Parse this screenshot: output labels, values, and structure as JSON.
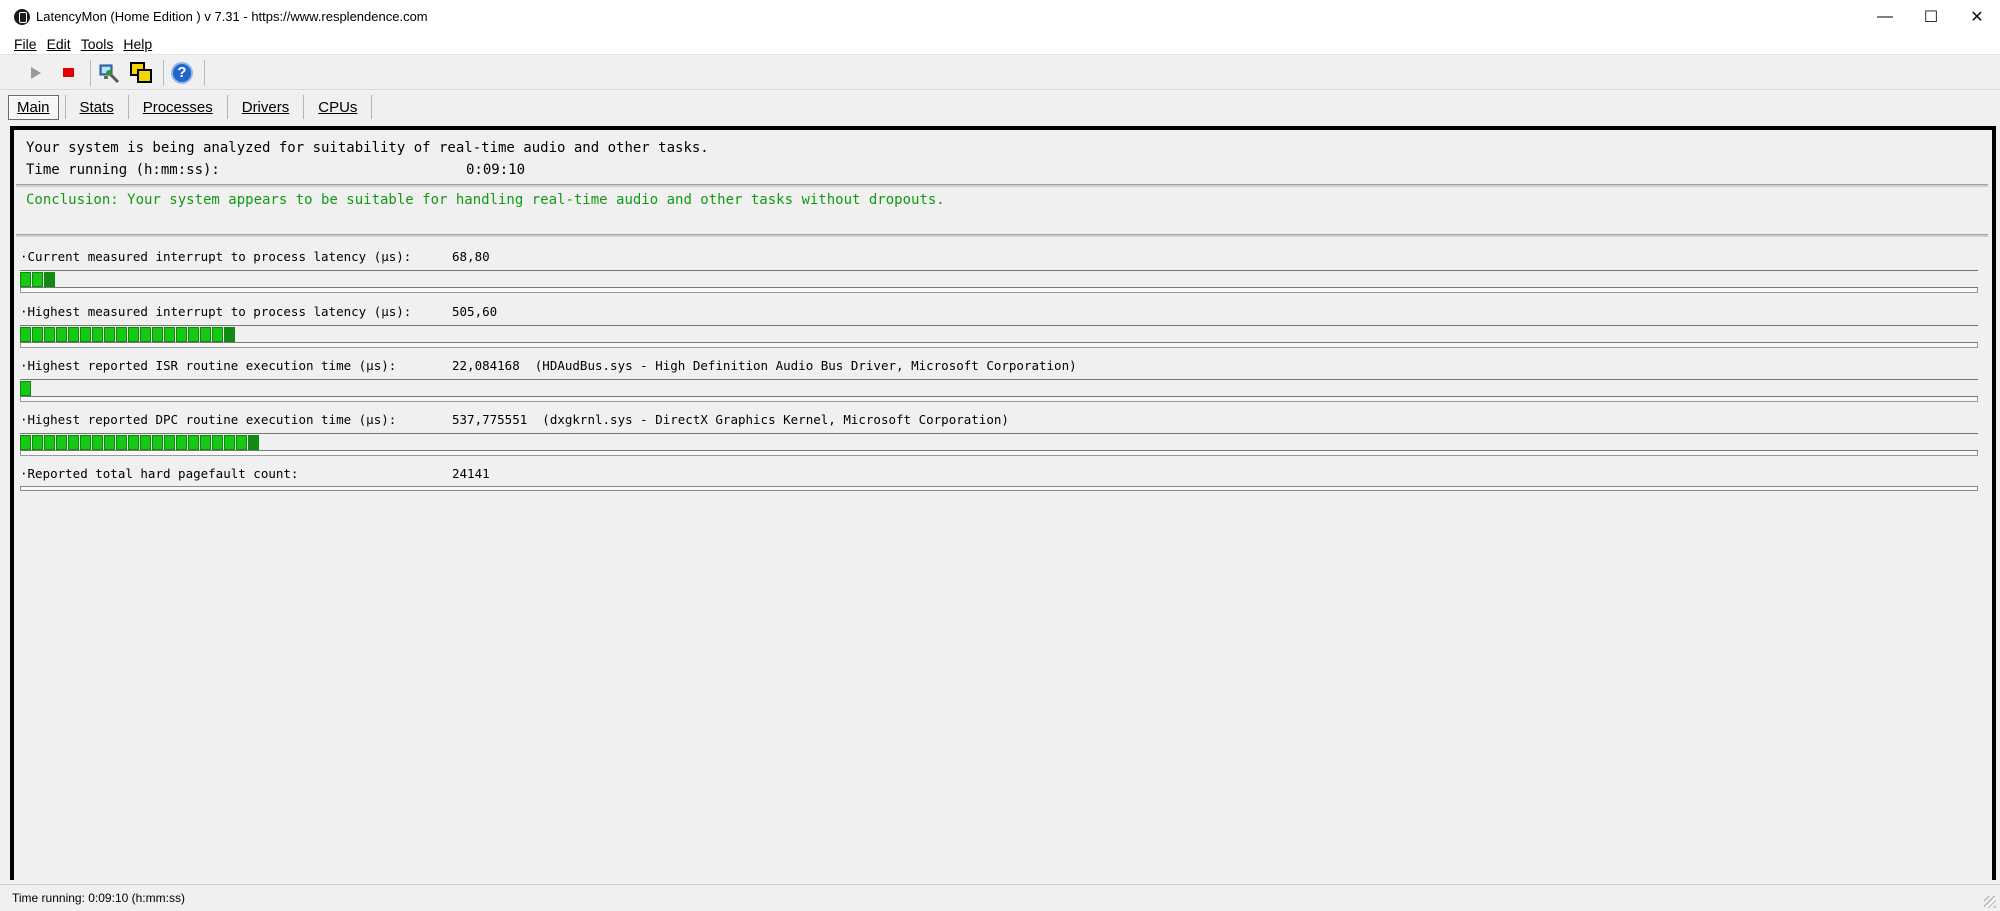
{
  "window": {
    "title": "LatencyMon  (Home Edition )  v 7.31 - https://www.resplendence.com",
    "minimize": "—",
    "maximize": "☐",
    "close": "✕"
  },
  "menu": [
    {
      "label": "File"
    },
    {
      "label": "Edit"
    },
    {
      "label": "Tools"
    },
    {
      "label": "Help"
    }
  ],
  "toolbar": {
    "help_glyph": "?"
  },
  "tabs": [
    {
      "label": "Main",
      "active": true
    },
    {
      "label": "Stats"
    },
    {
      "label": "Processes"
    },
    {
      "label": "Drivers"
    },
    {
      "label": "CPUs"
    }
  ],
  "summary": {
    "analyzing": "Your system is being analyzed for suitability of real-time audio and other tasks.",
    "time_label": "Time running (h:mm:ss):",
    "time_value": "0:09:10",
    "conclusion": "Conclusion: Your system appears to be suitable for handling real-time audio and other tasks without dropouts.",
    "conclusion_color": "#129a12"
  },
  "metrics": [
    {
      "label": "·Current measured interrupt to process latency (µs):",
      "value": "68,80",
      "segments": 3
    },
    {
      "label": "·Highest measured interrupt to process latency (µs):",
      "value": "505,60",
      "segments": 18
    },
    {
      "label": "·Highest reported ISR routine execution time (µs):",
      "value": "22,084168  (HDAudBus.sys - High Definition Audio Bus Driver, Microsoft Corporation)",
      "segments": 1
    },
    {
      "label": "·Highest reported DPC routine execution time (µs):",
      "value": "537,775551  (dxgkrnl.sys - DirectX Graphics Kernel, Microsoft Corporation)",
      "segments": 20
    },
    {
      "label": "·Reported total hard pagefault count:",
      "value": "24141"
    }
  ],
  "status": {
    "text": "Time running: 0:09:10  (h:mm:ss)"
  },
  "colors": {
    "bar_green": "#15c915",
    "bar_dark_green": "#138a13"
  }
}
